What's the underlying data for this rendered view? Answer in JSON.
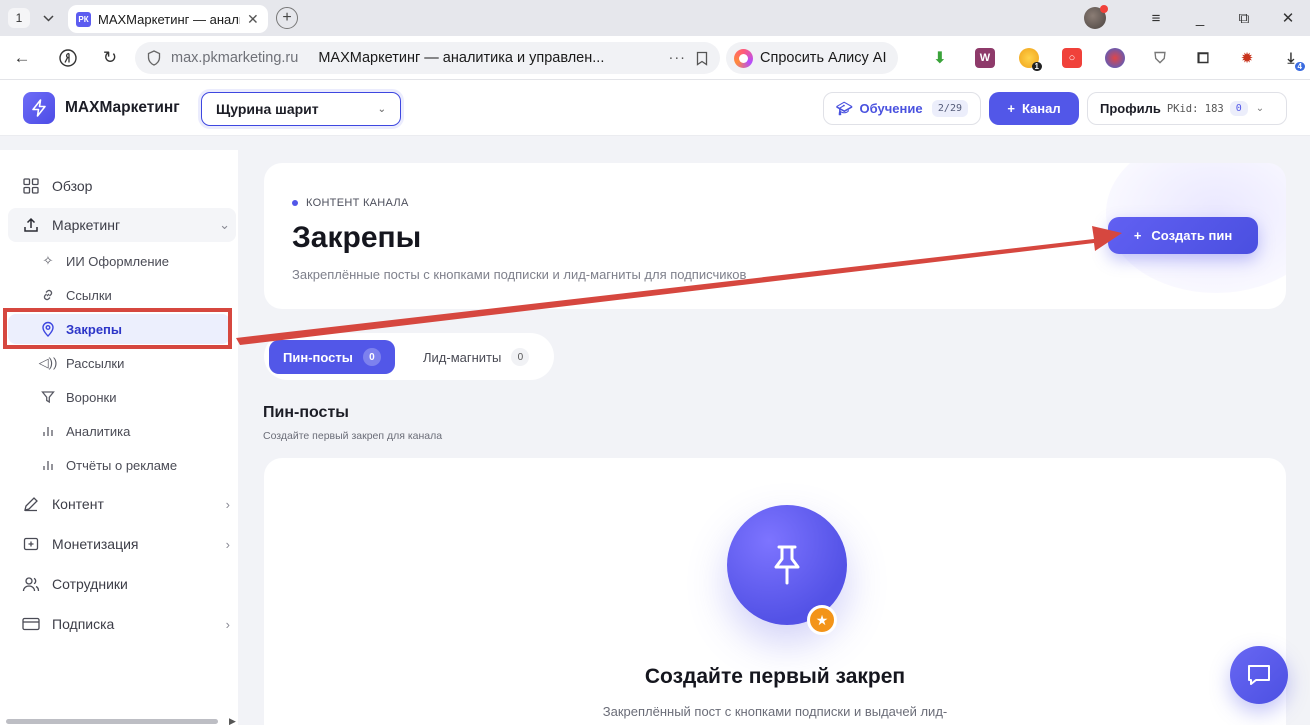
{
  "browser": {
    "tab_counter": "1",
    "tab_title": "MAXМаркетинг — аналитика",
    "tab_favicon": "РК",
    "url_domain": "max.pkmarketing.ru",
    "url_title": "MAXМаркетинг — аналитика и управлен...",
    "url_more": "···",
    "alice_label": "Спросить Алису AI",
    "ext_badge_1": "1",
    "ext_badge_2": "4",
    "ext_w": "W"
  },
  "header": {
    "logo_text": "MAXМаркетинг",
    "channel_selected": "Щурина шарит",
    "learn_label": "Обучение",
    "learn_count": "2/29",
    "add_channel_label": "Канал",
    "profile_label": "Профиль",
    "profile_id": "PKid: 183",
    "profile_count": "0"
  },
  "sidebar": {
    "overview": "Обзор",
    "marketing": "Маркетинг",
    "sub": {
      "ai_design": "ИИ Оформление",
      "links": "Ссылки",
      "pins": "Закрепы",
      "mailings": "Рассылки",
      "funnels": "Воронки",
      "analytics": "Аналитика",
      "ad_reports": "Отчёты о рекламе"
    },
    "content": "Контент",
    "monetization": "Монетизация",
    "staff": "Сотрудники",
    "subscription": "Подписка"
  },
  "hero": {
    "eyebrow": "КОНТЕНТ КАНАЛА",
    "title": "Закрепы",
    "subtitle": "Закреплённые посты с кнопками подписки и лид-магниты для подписчиков",
    "create_label": "Создать пин"
  },
  "tabs": {
    "pin_posts": "Пин-посты",
    "pin_posts_count": "0",
    "lead_magnets": "Лид-магниты",
    "lead_magnets_count": "0"
  },
  "section": {
    "title": "Пин-посты",
    "subtitle": "Создайте первый закреп для канала"
  },
  "empty": {
    "title": "Создайте первый закреп",
    "description": "Закреплённый пост с кнопками подписки и выдачей лид-"
  },
  "colors": {
    "accent": "#5257e8",
    "annotation": "#d6473f",
    "badge_orange": "#f39419"
  }
}
